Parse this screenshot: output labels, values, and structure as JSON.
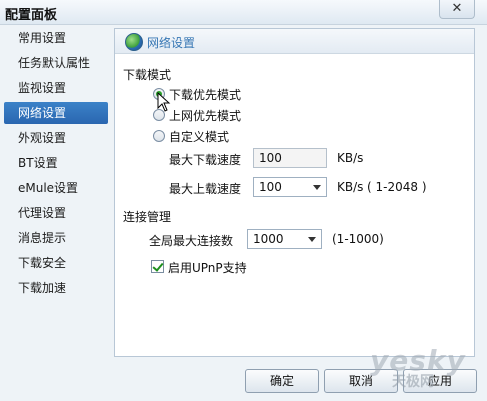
{
  "window": {
    "title": "配置面板",
    "close_label": "✕"
  },
  "sidebar": {
    "items": [
      {
        "label": "常用设置"
      },
      {
        "label": "任务默认属性"
      },
      {
        "label": "监视设置"
      },
      {
        "label": "网络设置"
      },
      {
        "label": "外观设置"
      },
      {
        "label": "BT设置"
      },
      {
        "label": "eMule设置"
      },
      {
        "label": "代理设置"
      },
      {
        "label": "消息提示"
      },
      {
        "label": "下载安全"
      },
      {
        "label": "下载加速"
      }
    ],
    "selected": "网络设置"
  },
  "panel": {
    "title": "网络设置",
    "download_mode": {
      "heading": "下载模式",
      "options": [
        {
          "label": "下载优先模式",
          "checked": true
        },
        {
          "label": "上网优先模式",
          "checked": false
        },
        {
          "label": "自定义模式",
          "checked": false
        }
      ],
      "max_download": {
        "label": "最大下载速度",
        "value": "100",
        "unit": "KB/s"
      },
      "max_upload": {
        "label": "最大上载速度",
        "value": "100",
        "unit": "KB/s",
        "range": "( 1-2048 )"
      }
    },
    "connection": {
      "heading": "连接管理",
      "max_connections": {
        "label": "全局最大连接数",
        "value": "1000",
        "range": "(1-1000)"
      },
      "upnp": {
        "label": "启用UPnP支持",
        "checked": true
      }
    }
  },
  "footer": {
    "ok_label": "确定",
    "cancel_label": "取消",
    "apply_label": "应用"
  },
  "watermark": {
    "text": "yesky",
    "sub": "天极网"
  }
}
